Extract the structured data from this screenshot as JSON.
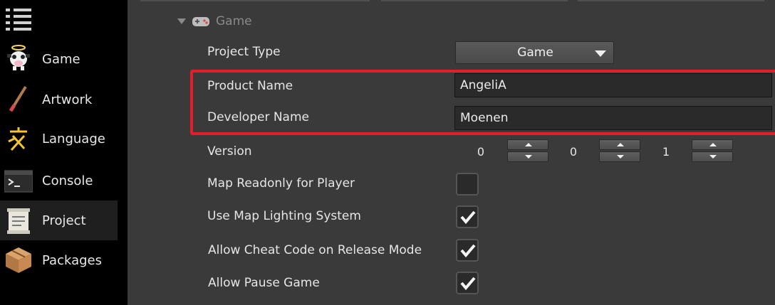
{
  "sidebar": {
    "items": [
      {
        "label": "Game",
        "icon": "cow-icon"
      },
      {
        "label": "Artwork",
        "icon": "paintbrush-icon"
      },
      {
        "label": "Language",
        "icon": "language-glyph-icon"
      },
      {
        "label": "Console",
        "icon": "terminal-icon"
      },
      {
        "label": "Project",
        "icon": "scroll-icon",
        "active": true
      },
      {
        "label": "Packages",
        "icon": "crate-icon"
      }
    ]
  },
  "section": {
    "title": "Game",
    "icon": "gamepad-icon"
  },
  "fields": {
    "project_type": {
      "label": "Project Type",
      "value": "Game"
    },
    "product_name": {
      "label": "Product Name",
      "value": "AngeliA"
    },
    "developer_name": {
      "label": "Developer Name",
      "value": "Moenen"
    },
    "version": {
      "label": "Version",
      "major": "0",
      "minor": "0",
      "patch": "1"
    },
    "map_readonly": {
      "label": "Map Readonly for Player",
      "checked": false
    },
    "map_lighting": {
      "label": "Use Map Lighting System",
      "checked": true
    },
    "cheat_code": {
      "label": "Allow Cheat Code on Release Mode",
      "checked": true
    },
    "pause_game": {
      "label": "Allow Pause Game",
      "checked": true
    }
  },
  "colors": {
    "highlight": "#e21e2a",
    "panel_bg": "#3a3a3a",
    "sidebar_bg": "#000000"
  }
}
